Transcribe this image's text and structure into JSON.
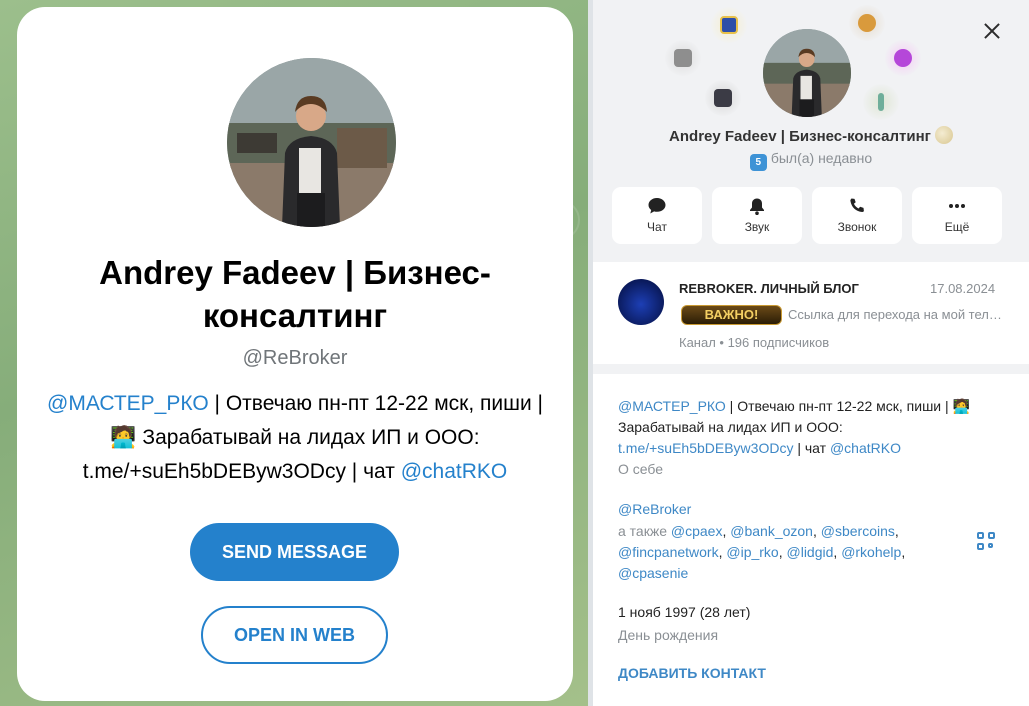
{
  "web_card": {
    "name": "Andrey Fadeev | Бизнес-консалтинг",
    "username": "@ReBroker",
    "bio_link1": "@МАСТЕР_РКО",
    "bio_text1": " | Отвечаю пн-пт 12-22 мск, пиши | ",
    "bio_emoji": "🧑‍💻",
    "bio_text2": " Зарабатывай на лидах ИП и ООО: t.me/+suEh5bDEByw3ODcy | чат ",
    "bio_link2": "@chatRKO",
    "send_button": "SEND MESSAGE",
    "web_button": "OPEN IN WEB"
  },
  "profile_panel": {
    "name": "Andrey Fadeev | Бизнес-консалтинг",
    "level": "5",
    "status": "был(а) недавно",
    "actions": [
      {
        "label": "Чат",
        "icon": "chat-bubble-icon"
      },
      {
        "label": "Звук",
        "icon": "bell-icon"
      },
      {
        "label": "Звонок",
        "icon": "phone-icon"
      },
      {
        "label": "Ещё",
        "icon": "more-dots-icon"
      }
    ],
    "channel": {
      "title": "REBROKER. ЛИЧНЫЙ БЛОГ",
      "date": "17.08.2024",
      "badge": "ВАЖНО!",
      "preview": "Ссылка для перехода на мой телеграм",
      "subtitle": "Канал • 196 подписчиков"
    },
    "bio": {
      "link1": "@МАСТЕР_РКО",
      "text1": " | Отвечаю пн-пт 12-22 мск, пиши | ",
      "emoji": "🧑‍💻",
      "text2": " Зарабатывай на лидах ИП и ООО: ",
      "link2": "t.me/+suEh5bDEByw3ODcy",
      "text3": " | чат ",
      "link3": "@chatRKO",
      "caption": "О себе"
    },
    "username": {
      "value": "@ReBroker",
      "also_prefix": "а также ",
      "also_links": [
        "@cpaex",
        "@bank_ozon",
        "@sbercoins",
        "@fincpanetwork",
        "@ip_rko",
        "@lidgid",
        "@rkohelp",
        "@cpasenie"
      ]
    },
    "birthday": {
      "value": "1 нояб 1997 (28 лет)",
      "caption": "День рождения"
    },
    "add_contact": "ДОБАВИТЬ КОНТАКТ"
  },
  "colors": {
    "accent": "#2481cc",
    "link": "#3e88c6",
    "muted": "#8a8f94"
  }
}
